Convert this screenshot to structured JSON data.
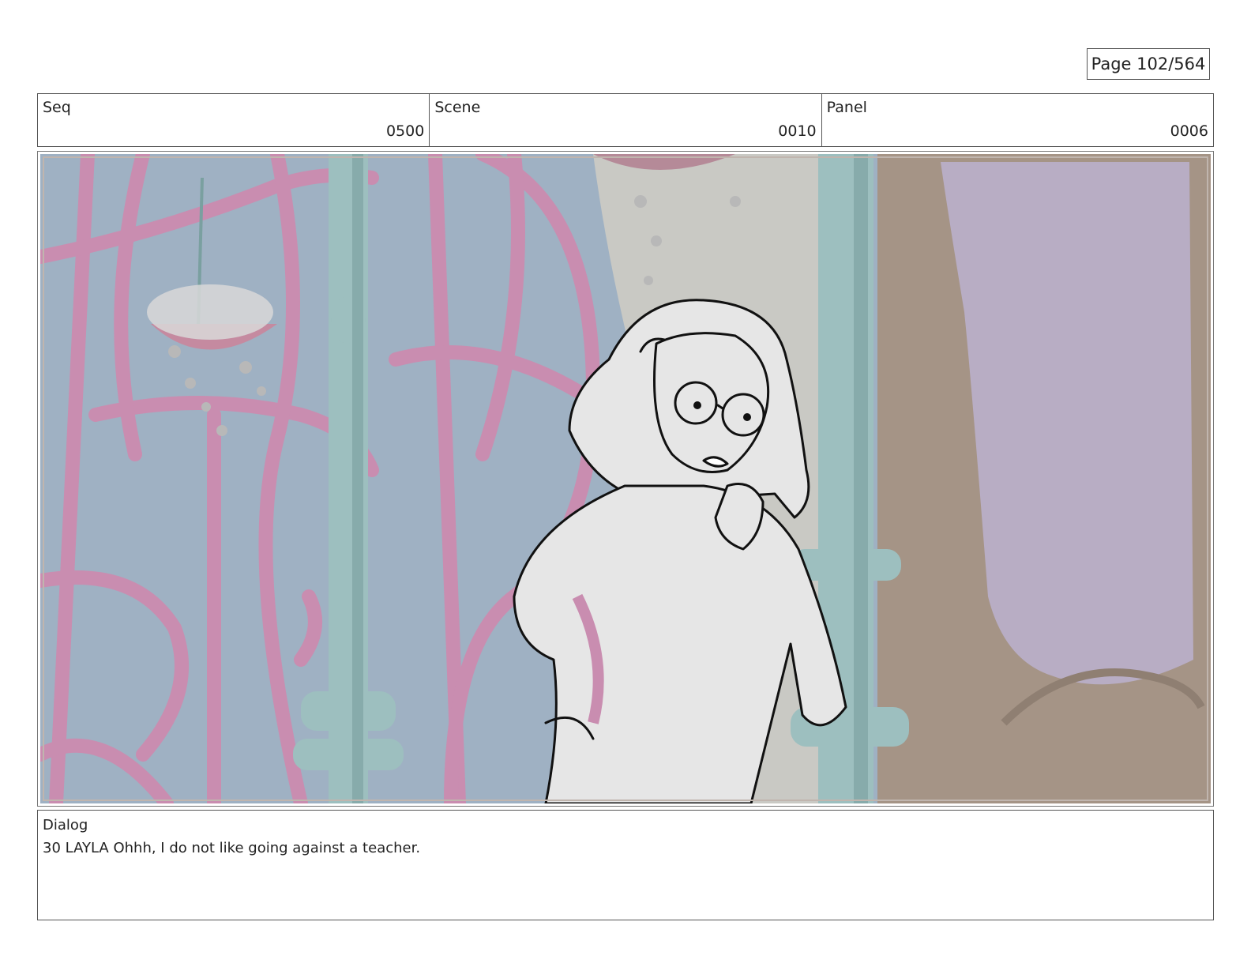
{
  "page": {
    "label": "Page 102/564"
  },
  "header": {
    "seq": {
      "label": "Seq",
      "value": "0500"
    },
    "scene": {
      "label": "Scene",
      "value": "0010"
    },
    "panel": {
      "label": "Panel",
      "value": "0006"
    }
  },
  "dialog": {
    "label": "Dialog",
    "text": "30 LAYLA Ohhh, I do not like going against a teacher."
  },
  "colors": {
    "wall_blue": "#9fb1c3",
    "ironwork_pink": "#c98db0",
    "column_teal": "#9dbfbf",
    "mirror_lavender": "#b8adc4",
    "frame_brown": "#a59486",
    "sketch_fill": "#e6e6e6"
  }
}
